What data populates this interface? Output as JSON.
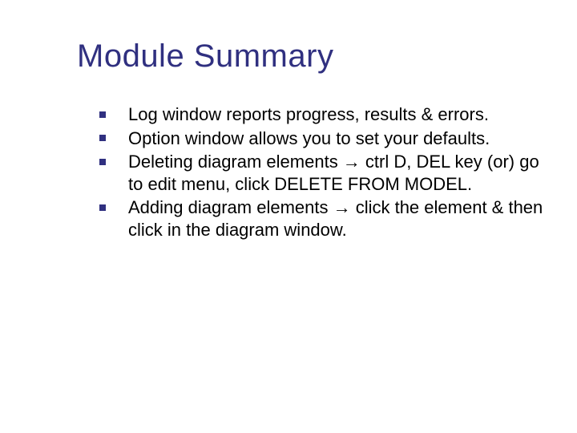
{
  "slide": {
    "title": "Module Summary",
    "bullets": [
      "Log window reports progress, results & errors.",
      "Option window allows you to set your defaults.",
      "Deleting diagram elements → ctrl D, DEL key (or) go to edit menu, click DELETE FROM MODEL.",
      "Adding diagram elements → click the element & then click in the diagram window."
    ]
  }
}
